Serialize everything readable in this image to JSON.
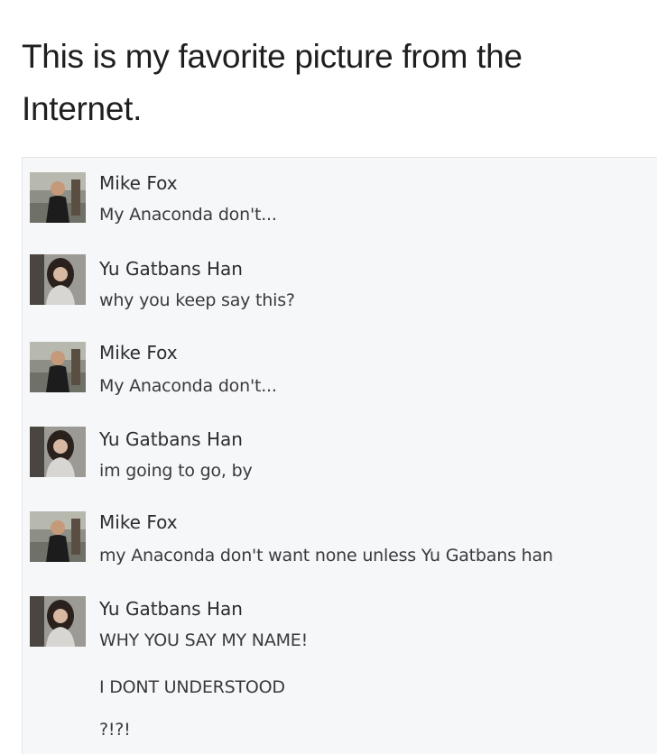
{
  "caption": "This is my favorite picture from the Internet.",
  "messages": [
    {
      "sender": "Mike Fox",
      "avatar": "man-avatar-icon",
      "lines": [
        "My Anaconda don't..."
      ]
    },
    {
      "sender": "Yu Gatbans Han",
      "avatar": "woman-avatar-icon",
      "lines": [
        "why you keep say this?"
      ]
    },
    {
      "sender": "Mike Fox",
      "avatar": "man-avatar-icon",
      "lines": [
        "My Anaconda don't..."
      ]
    },
    {
      "sender": "Yu Gatbans Han",
      "avatar": "woman-avatar-icon",
      "lines": [
        "im going to go, by"
      ]
    },
    {
      "sender": "Mike Fox",
      "avatar": "man-avatar-icon",
      "lines": [
        "my Anaconda don't want none unless Yu Gatbans han"
      ]
    },
    {
      "sender": "Yu Gatbans Han",
      "avatar": "woman-avatar-icon",
      "lines": [
        "WHY YOU SAY MY NAME!",
        "I DONT UNDERSTOOD",
        "?!?!"
      ]
    }
  ]
}
